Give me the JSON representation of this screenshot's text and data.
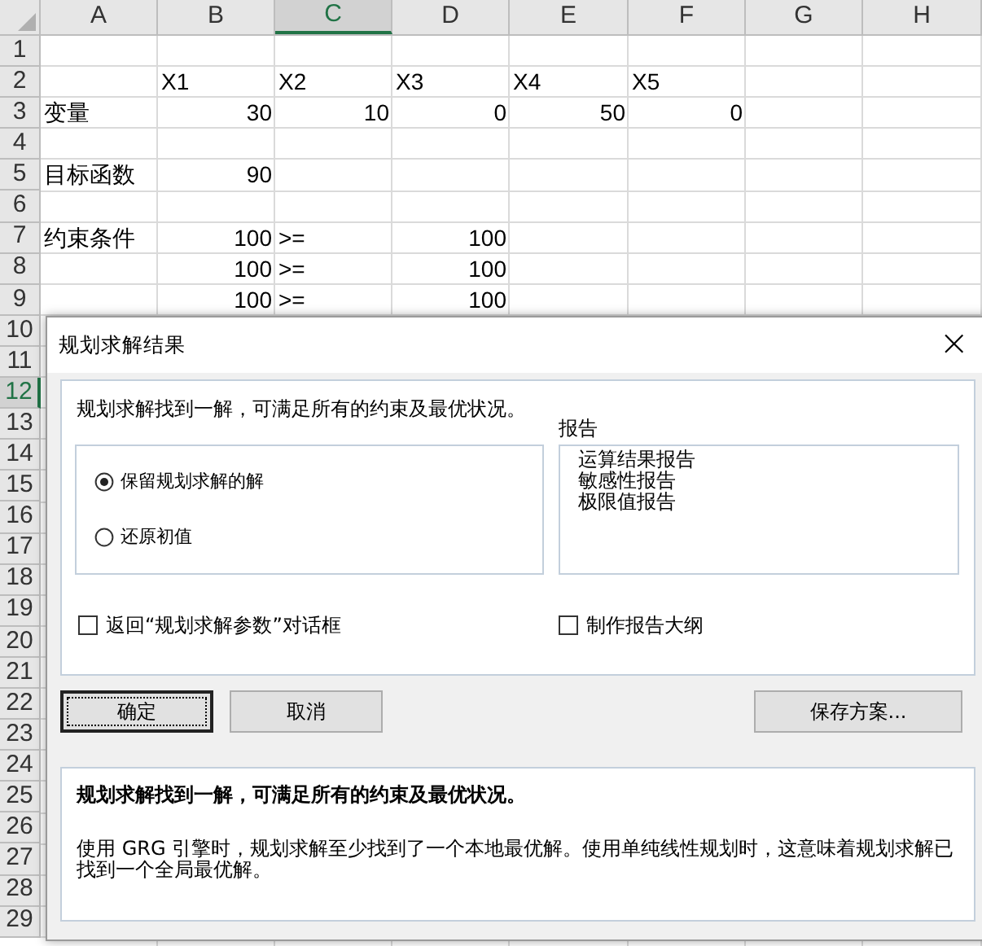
{
  "sheet": {
    "columns": [
      {
        "label": "A",
        "selected": false
      },
      {
        "label": "B",
        "selected": false
      },
      {
        "label": "C",
        "selected": true
      },
      {
        "label": "D",
        "selected": false
      },
      {
        "label": "E",
        "selected": false
      },
      {
        "label": "F",
        "selected": false
      },
      {
        "label": "G",
        "selected": false
      },
      {
        "label": "H",
        "selected": false
      }
    ],
    "rows": [
      {
        "label": "1",
        "selected": false
      },
      {
        "label": "2",
        "selected": false,
        "cells": [
          null,
          {
            "text": "X1",
            "kind": "text"
          },
          {
            "text": "X2",
            "kind": "text"
          },
          {
            "text": "X3",
            "kind": "text"
          },
          {
            "text": "X4",
            "kind": "text"
          },
          {
            "text": "X5",
            "kind": "text"
          }
        ]
      },
      {
        "label": "3",
        "selected": false,
        "cells": [
          {
            "text": "变量",
            "kind": "text"
          },
          {
            "text": "30",
            "kind": "number"
          },
          {
            "text": "10",
            "kind": "number"
          },
          {
            "text": "0",
            "kind": "number"
          },
          {
            "text": "50",
            "kind": "number"
          },
          {
            "text": "0",
            "kind": "number"
          }
        ]
      },
      {
        "label": "4",
        "selected": false
      },
      {
        "label": "5",
        "selected": false,
        "cells": [
          {
            "text": "目标函数",
            "kind": "text"
          },
          {
            "text": "90",
            "kind": "number"
          }
        ]
      },
      {
        "label": "6",
        "selected": false
      },
      {
        "label": "7",
        "selected": false,
        "cells": [
          {
            "text": "约束条件",
            "kind": "text"
          },
          {
            "text": "100",
            "kind": "number"
          },
          {
            "text": ">=",
            "kind": "text"
          },
          {
            "text": "100",
            "kind": "number"
          }
        ]
      },
      {
        "label": "8",
        "selected": false,
        "cells": [
          null,
          {
            "text": "100",
            "kind": "number"
          },
          {
            "text": ">=",
            "kind": "text"
          },
          {
            "text": "100",
            "kind": "number"
          }
        ]
      },
      {
        "label": "9",
        "selected": false,
        "cells": [
          null,
          {
            "text": "100",
            "kind": "number"
          },
          {
            "text": ">=",
            "kind": "text"
          },
          {
            "text": "100",
            "kind": "number"
          }
        ]
      },
      {
        "label": "10",
        "selected": false
      },
      {
        "label": "11",
        "selected": false
      },
      {
        "label": "12",
        "selected": true
      },
      {
        "label": "13",
        "selected": false
      },
      {
        "label": "14",
        "selected": false
      },
      {
        "label": "15",
        "selected": false
      },
      {
        "label": "16",
        "selected": false
      },
      {
        "label": "17",
        "selected": false
      },
      {
        "label": "18",
        "selected": false
      },
      {
        "label": "19",
        "selected": false
      },
      {
        "label": "20",
        "selected": false
      },
      {
        "label": "21",
        "selected": false
      },
      {
        "label": "22",
        "selected": false
      },
      {
        "label": "23",
        "selected": false
      },
      {
        "label": "24",
        "selected": false
      },
      {
        "label": "25",
        "selected": false
      },
      {
        "label": "26",
        "selected": false
      },
      {
        "label": "27",
        "selected": false
      },
      {
        "label": "28",
        "selected": false
      },
      {
        "label": "29",
        "selected": false
      }
    ]
  },
  "dialog": {
    "title": "规划求解结果",
    "close": "×",
    "message": "规划求解找到一解，可满足所有的约束及最优状况。",
    "options": [
      {
        "label": "保留规划求解的解",
        "selected": true
      },
      {
        "label": "还原初值",
        "selected": false
      }
    ],
    "reports_label": "报告",
    "reports": [
      "运算结果报告",
      "敏感性报告",
      "极限值报告"
    ],
    "checkboxes": [
      {
        "label": "返回“规划求解参数”对话框",
        "checked": false
      },
      {
        "label": "制作报告大纲",
        "checked": false
      }
    ],
    "buttons": [
      {
        "label": "确定",
        "default": true
      },
      {
        "label": "取消",
        "default": false
      },
      {
        "label": "保存方案...",
        "default": false
      }
    ],
    "info": {
      "heading": "规划求解找到一解，可满足所有的约束及最优状况。",
      "body": "使用 GRG 引擎时，规划求解至少找到了一个本地最优解。使用单纯线性规划时，这意味着规划求解已找到一个全局最优解。"
    }
  }
}
